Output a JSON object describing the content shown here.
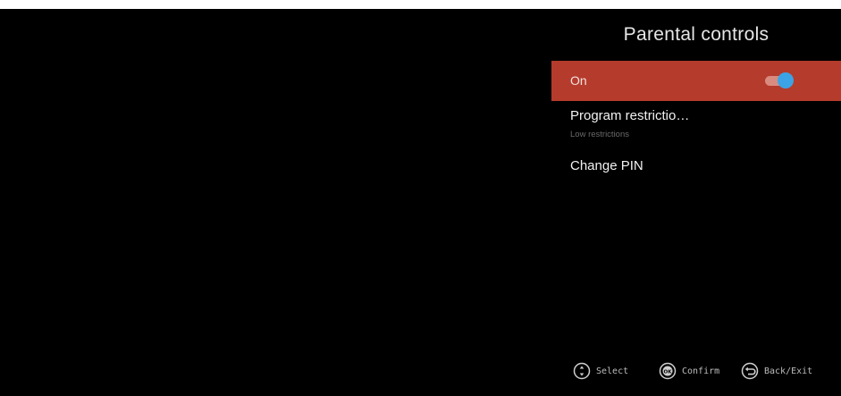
{
  "panel": {
    "title": "Parental controls"
  },
  "menu": {
    "items": [
      {
        "label": "On",
        "toggle_state": "on",
        "selected": true
      },
      {
        "label": "Program restrictio…",
        "sublabel": "Low restrictions"
      },
      {
        "label": "Change PIN"
      }
    ]
  },
  "hints": [
    {
      "icon": "dpad-icon",
      "label": "Select"
    },
    {
      "icon": "ok-button-icon",
      "label": "Confirm"
    },
    {
      "icon": "back-arrow-icon",
      "label": "Back/Exit"
    }
  ],
  "colors": {
    "background": "#000000",
    "selected_row": "#b53b2c",
    "toggle_knob": "#3ca3e6",
    "toggle_track": "#d98b80"
  }
}
